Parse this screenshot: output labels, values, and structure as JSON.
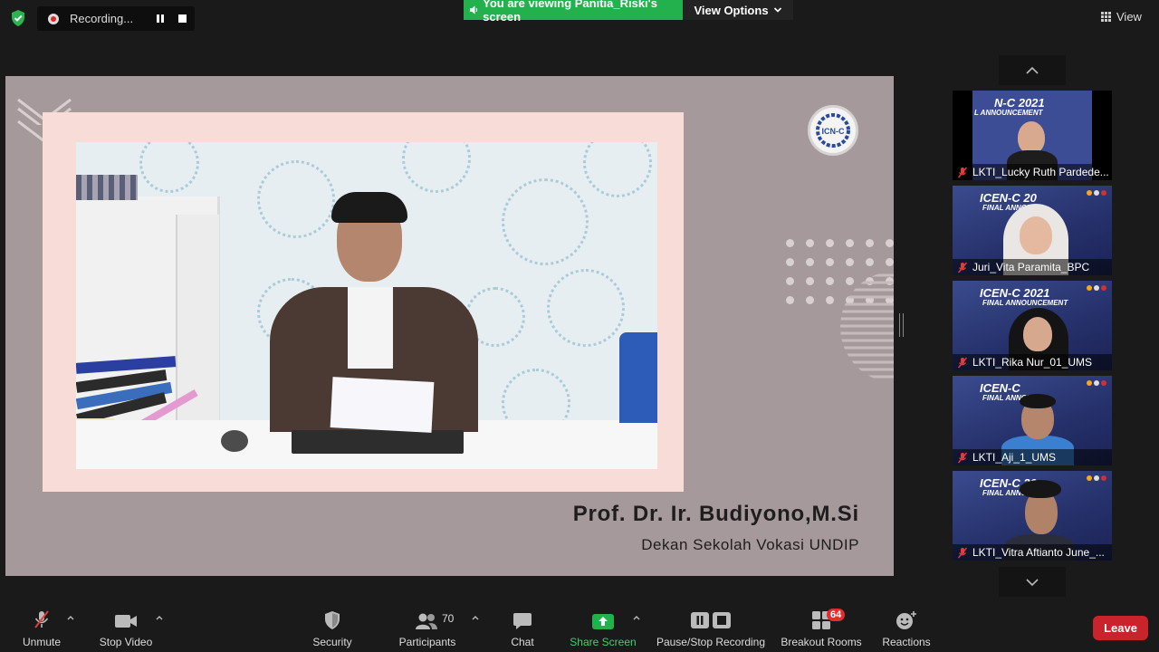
{
  "top_bar": {
    "recording_label": "Recording...",
    "viewing_banner": "You are viewing Panitia_Riski's screen",
    "view_options": "View Options",
    "view_label": "View"
  },
  "shared_screen": {
    "speaker_name": "Prof. Dr. Ir. Budiyono,M.Si",
    "speaker_title": "Dekan Sekolah Vokasi UNDIP",
    "logo_text": "ICN-C"
  },
  "gallery": {
    "tiles": [
      {
        "name": "LKTI_Lucky Ruth Pardede...",
        "banner": "N-C 2021",
        "sub": "L ANNOUNCEMENT"
      },
      {
        "name": "Juri_Vita Paramita_BPC",
        "banner": "ICEN-C 20",
        "sub": "FINAL ANNOU"
      },
      {
        "name": "LKTI_Rika Nur_01_UMS",
        "banner": "ICEN-C 2021",
        "sub": "FINAL ANNOUNCEMENT"
      },
      {
        "name": "LKTI_Aji_1_UMS",
        "banner": "ICEN-C",
        "sub": "FINAL ANNOU"
      },
      {
        "name": "LKTI_Vitra Aftianto June_...",
        "banner": "ICEN-C 20",
        "sub": "FINAL ANNOU"
      }
    ]
  },
  "toolbar": {
    "unmute": "Unmute",
    "stop_video": "Stop Video",
    "security": "Security",
    "participants": "Participants",
    "participants_count": "70",
    "chat": "Chat",
    "share_screen": "Share Screen",
    "pause_stop_recording": "Pause/Stop Recording",
    "breakout_rooms": "Breakout Rooms",
    "breakout_badge": "64",
    "reactions": "Reactions",
    "leave": "Leave"
  },
  "colors": {
    "share_green": "#22b14c",
    "leave_red": "#c9242b",
    "badge_red": "#e02d2d"
  }
}
